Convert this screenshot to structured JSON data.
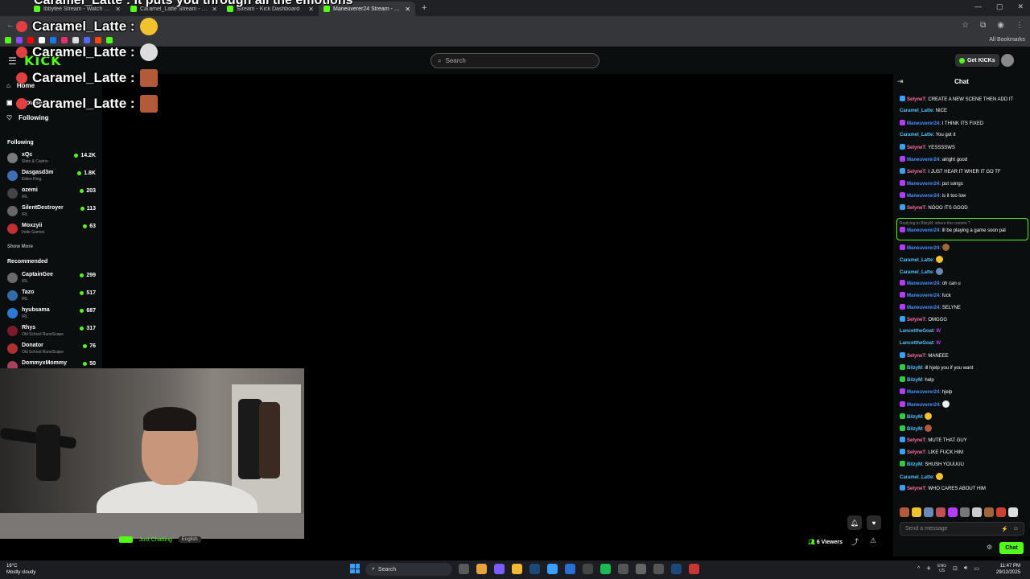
{
  "browser": {
    "tabs": [
      {
        "title": "Ibbytee Stream - Watch Live",
        "active": false
      },
      {
        "title": "Caramel_Latte Stream - Watc",
        "active": false
      },
      {
        "title": "Stream - Kick Dashboard",
        "active": false
      },
      {
        "title": "Maneuverer24 Stream - Watch",
        "active": true
      }
    ],
    "all_bookmarks": "All Bookmarks"
  },
  "kick": {
    "logo": "KICK",
    "search_placeholder": "Search",
    "get_kicks": "Get KICKs"
  },
  "overlay": {
    "title": "Caramel_Latte : It puts you through all the emotions",
    "alerts": [
      {
        "name": "Caramel_Latte :",
        "emote_color": "#f2c12e"
      },
      {
        "name": "Caramel_Latte :",
        "emote_color": "#dddddd"
      },
      {
        "name": "Caramel_Latte :",
        "emote_color": "#b35a3a"
      },
      {
        "name": "Caramel_Latte :",
        "emote_color": "#b35a3a"
      }
    ]
  },
  "sidebar": {
    "nav": [
      {
        "label": "Home",
        "icon": "home-icon"
      },
      {
        "label": "Browse",
        "icon": "browse-icon"
      },
      {
        "label": "Following",
        "icon": "heart-icon"
      }
    ],
    "following_title": "Following",
    "following": [
      {
        "name": "xQc",
        "category": "Slots & Casino",
        "viewers": "14.2K",
        "color": "#7a7a7a"
      },
      {
        "name": "Dasgasd3m",
        "category": "Elden Ring",
        "viewers": "1.8K",
        "color": "#3e6fb5"
      },
      {
        "name": "ozemi",
        "category": "IRL",
        "viewers": "203",
        "color": "#444"
      },
      {
        "name": "SilentDestroyer",
        "category": "IRL",
        "viewers": "113",
        "color": "#666"
      },
      {
        "name": "Moxzyii",
        "category": "Indie Games",
        "viewers": "63",
        "color": "#c03030"
      }
    ],
    "show_more": "Show More",
    "recommended_title": "Recommended",
    "recommended": [
      {
        "name": "CaptainGee",
        "category": "IRL",
        "viewers": "299",
        "color": "#6a6a6a"
      },
      {
        "name": "Tazo",
        "category": "IRL",
        "viewers": "517",
        "color": "#2d6ca8"
      },
      {
        "name": "hyubsama",
        "category": "IRL",
        "viewers": "687",
        "color": "#2a7ad8"
      },
      {
        "name": "Rhys",
        "category": "Old School RuneScape",
        "viewers": "317",
        "color": "#7a1a2a"
      },
      {
        "name": "Donator",
        "category": "Old School RuneScape",
        "viewers": "76",
        "color": "#b03030"
      },
      {
        "name": "DommyxMommy",
        "category": "",
        "viewers": "50",
        "color": "#aa4060"
      }
    ]
  },
  "stream": {
    "category": "Just Chatting",
    "language": "English",
    "viewers": "6 Viewers"
  },
  "chat": {
    "title": "Chat",
    "messages": [
      {
        "user": "SelyneT",
        "color": "#ff6fa0",
        "badge": "#3aa0ff",
        "text": "CREATE A NEW SCENE THEN ADD IT"
      },
      {
        "user": "Caramel_Latte",
        "color": "#53c0ff",
        "badge": "",
        "text": "NICE"
      },
      {
        "user": "Maneuverer24",
        "color": "#4a8fff",
        "badge": "#b43cff",
        "text": "I THINK ITS FIXED"
      },
      {
        "user": "Caramel_Latte",
        "color": "#53c0ff",
        "badge": "",
        "text": "You got it"
      },
      {
        "user": "SelyneT",
        "color": "#ff6fa0",
        "badge": "#3aa0ff",
        "text": "YESSSSWS"
      },
      {
        "user": "Maneuverer24",
        "color": "#4a8fff",
        "badge": "#b43cff",
        "text": "alright good"
      },
      {
        "user": "SelyneT",
        "color": "#ff6fa0",
        "badge": "#3aa0ff",
        "text": "I JUST HEAR IT WHER IT GO TF"
      },
      {
        "user": "Maneuverer24",
        "color": "#4a8fff",
        "badge": "#b43cff",
        "text": "put songs"
      },
      {
        "user": "Maneuverer24",
        "color": "#4a8fff",
        "badge": "#b43cff",
        "text": "is it too low"
      },
      {
        "user": "SelyneT",
        "color": "#ff6fa0",
        "badge": "#3aa0ff",
        "text": "NOOO ITS GOOD"
      },
      {
        "user": "Maneuverer24",
        "color": "#4a8fff",
        "badge": "#b43cff",
        "text": "ill be playing a game soon pal",
        "reply": "Replying to BilzyM: where the content ?"
      },
      {
        "user": "Maneuverer24",
        "color": "#4a8fff",
        "badge": "#b43cff",
        "text": "",
        "emote": "#a0663a"
      },
      {
        "user": "Caramel_Latte",
        "color": "#53c0ff",
        "badge": "",
        "text": "",
        "emote": "#f2c12e"
      },
      {
        "user": "Caramel_Latte",
        "color": "#53c0ff",
        "badge": "",
        "text": "",
        "emote": "#6a8ab5"
      },
      {
        "user": "Maneuverer24",
        "color": "#4a8fff",
        "badge": "#b43cff",
        "text": "oh can u"
      },
      {
        "user": "Maneuverer24",
        "color": "#4a8fff",
        "badge": "#b43cff",
        "text": "fuck"
      },
      {
        "user": "Maneuverer24",
        "color": "#4a8fff",
        "badge": "#b43cff",
        "text": "SELYNE"
      },
      {
        "user": "SelyneT",
        "color": "#ff6fa0",
        "badge": "#3aa0ff",
        "text": "OMGGG"
      },
      {
        "user": "LancettheGoat",
        "color": "#53c0ff",
        "badge": "",
        "text": "W",
        "w": true
      },
      {
        "user": "LancettheGoat",
        "color": "#53c0ff",
        "badge": "",
        "text": "W",
        "w": true
      },
      {
        "user": "SelyneT",
        "color": "#ff6fa0",
        "badge": "#3aa0ff",
        "text": "MANEEE"
      },
      {
        "user": "BilzyM",
        "color": "#53c0ff",
        "badge": "#2ecc40",
        "text": "ill hjelp you if you want"
      },
      {
        "user": "BilzyM",
        "color": "#53c0ff",
        "badge": "#2ecc40",
        "text": "help"
      },
      {
        "user": "Maneuverer24",
        "color": "#4a8fff",
        "badge": "#b43cff",
        "text": "hjelp"
      },
      {
        "user": "Maneuverer24",
        "color": "#4a8fff",
        "badge": "#b43cff",
        "text": "",
        "emote": "#eeeeee"
      },
      {
        "user": "BilzyM",
        "color": "#53c0ff",
        "badge": "#2ecc40",
        "text": "",
        "emote": "#f2c12e"
      },
      {
        "user": "BilzyM",
        "color": "#53c0ff",
        "badge": "#2ecc40",
        "text": "",
        "emote": "#b35a3a"
      },
      {
        "user": "SelyneT",
        "color": "#ff6fa0",
        "badge": "#3aa0ff",
        "text": "MUTE THAT GUY"
      },
      {
        "user": "SelyneT",
        "color": "#ff6fa0",
        "badge": "#3aa0ff",
        "text": "LIKE FUCK HIM"
      },
      {
        "user": "BilzyM",
        "color": "#53c0ff",
        "badge": "#2ecc40",
        "text": "SHUSH YOUUUU"
      },
      {
        "user": "Caramel_Latte",
        "color": "#53c0ff",
        "badge": "",
        "text": "",
        "emote": "#f2c12e"
      },
      {
        "user": "SelyneT",
        "color": "#ff6fa0",
        "badge": "#3aa0ff",
        "text": "WHO CARES ABOUT HIM"
      }
    ],
    "input_placeholder": "Send a message",
    "send_label": "Chat",
    "emote_strip": [
      "#b35a3a",
      "#f2c12e",
      "#6a8ab5",
      "#c05050",
      "#b43cff",
      "#777",
      "#ccc",
      "#a0663a",
      "#d04030",
      "#ddd"
    ]
  },
  "taskbar": {
    "temp": "16°C",
    "weather": "Mostly cloudy",
    "search": "Search",
    "lang_top": "ENG",
    "lang_bottom": "US",
    "time": "11:47 PM",
    "date": "29/12/2025"
  }
}
